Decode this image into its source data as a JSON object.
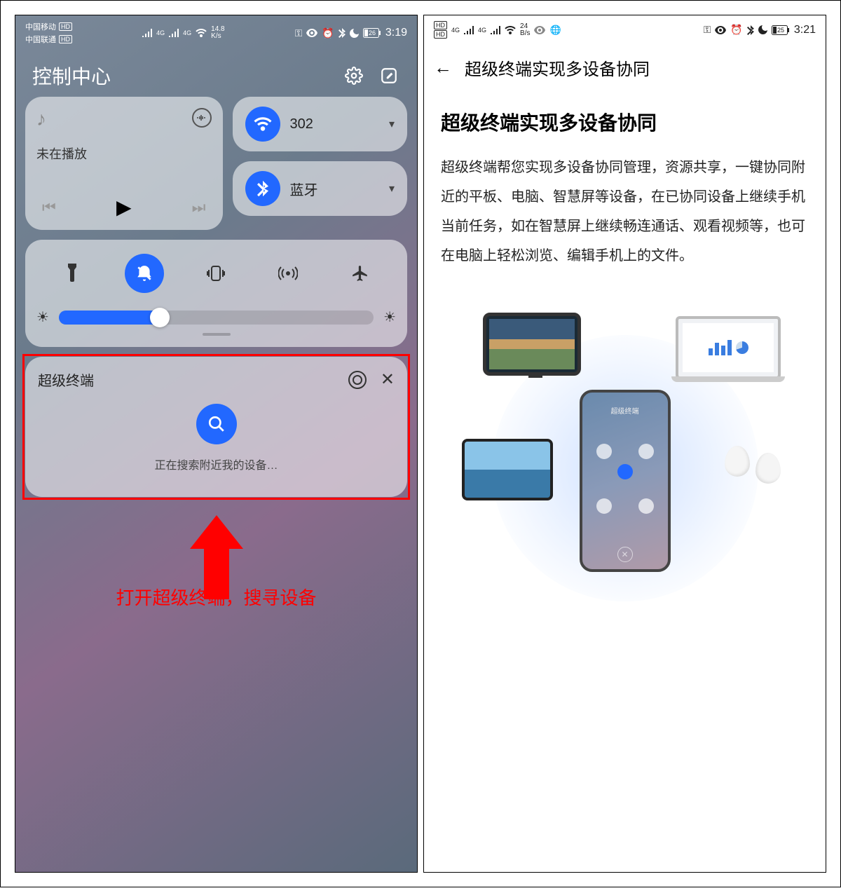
{
  "left": {
    "status": {
      "carrier1": "中国移动",
      "carrier2": "中国联通",
      "hd": "HD",
      "net": "4G",
      "speed_value": "14.8",
      "speed_unit": "K/s",
      "battery": "26",
      "time": "3:19"
    },
    "header": {
      "title": "控制中心"
    },
    "music": {
      "status": "未在播放"
    },
    "wifi": {
      "label": "302"
    },
    "bluetooth": {
      "label": "蓝牙"
    },
    "super": {
      "title": "超级终端",
      "searching": "正在搜索附近我的设备…"
    },
    "caption": "打开超级终端，搜寻设备"
  },
  "right": {
    "status": {
      "hd1": "HD",
      "hd2": "HD",
      "net": "4G",
      "speed_value": "24",
      "speed_unit": "B/s",
      "battery": "25",
      "time": "3:21"
    },
    "header": {
      "title": "超级终端实现多设备协同"
    },
    "article": {
      "h1": "超级终端实现多设备协同",
      "p": "超级终端帮您实现多设备协同管理，资源共享，一键协同附近的平板、电脑、智慧屏等设备，在已协同设备上继续手机当前任务，如在智慧屏上继续畅连通话、观看视频等，也可在电脑上轻松浏览、编辑手机上的文件。"
    },
    "phone_screen": {
      "title": "超级终端"
    }
  }
}
